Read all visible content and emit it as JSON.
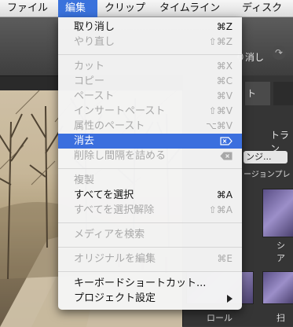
{
  "menubar": {
    "items": [
      "ファイル",
      "編集",
      "クリップ",
      "タイムライン",
      "ディスク"
    ],
    "active_index": 1
  },
  "background": {
    "toolbar_undo_partial": "り消し",
    "tab_partial": "ト",
    "transition_partial": "トラン",
    "dropdown_partial": "ンジ...",
    "plugin_partial": "ージョンプレ",
    "thumb_label_1": "シア",
    "thumb_label_2": "ロール",
    "thumb_label_3": "扫"
  },
  "edit_menu": {
    "items": [
      {
        "label": "取り消し",
        "shortcut": "⌘Z",
        "enabled": true
      },
      {
        "label": "やり直し",
        "shortcut": "⇧⌘Z",
        "enabled": false
      },
      {
        "label": "カット",
        "shortcut": "⌘X",
        "enabled": false
      },
      {
        "label": "コピー",
        "shortcut": "⌘C",
        "enabled": false
      },
      {
        "label": "ペースト",
        "shortcut": "⌘V",
        "enabled": false
      },
      {
        "label": "インサートペースト",
        "shortcut": "⇧⌘V",
        "enabled": false
      },
      {
        "label": "属性のペースト",
        "shortcut": "⌥⌘V",
        "enabled": false
      },
      {
        "label": "消去",
        "shortcut_icon": "delete-forward-icon",
        "enabled": true,
        "highlighted": true
      },
      {
        "label": "削除し間隔を詰める",
        "shortcut_icon": "delete-backward-icon",
        "enabled": false
      },
      {
        "label": "複製",
        "shortcut": "",
        "enabled": false
      },
      {
        "label": "すべてを選択",
        "shortcut": "⌘A",
        "enabled": true
      },
      {
        "label": "すべてを選択解除",
        "shortcut": "⇧⌘A",
        "enabled": false
      },
      {
        "label": "メディアを検索",
        "shortcut": "",
        "enabled": false
      },
      {
        "label": "オリジナルを編集",
        "shortcut": "⌘E",
        "enabled": false
      },
      {
        "label": "キーボードショートカット...",
        "shortcut": "",
        "enabled": true
      },
      {
        "label": "プロジェクト設定",
        "submenu": true,
        "enabled": true
      }
    ]
  },
  "colors": {
    "highlight": "#3b6fde",
    "menu_bg": "#f4f4f4",
    "disabled_text": "#a8a8a8"
  }
}
